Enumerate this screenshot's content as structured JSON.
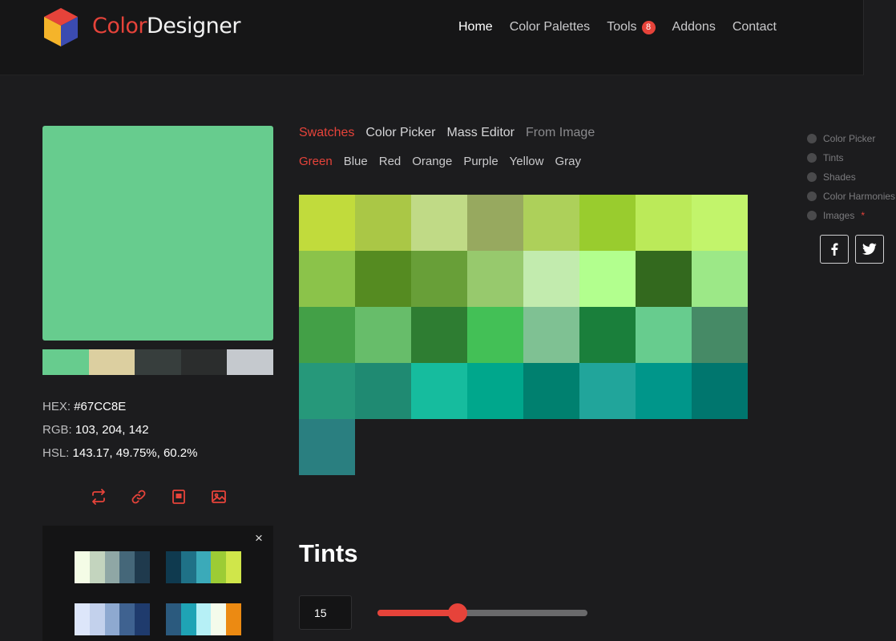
{
  "brand": {
    "name_part1": "Color",
    "name_part2": "Designer"
  },
  "nav": [
    {
      "label": "Home",
      "active": true
    },
    {
      "label": "Color Palettes"
    },
    {
      "label": "Tools",
      "badge": "8"
    },
    {
      "label": "Addons"
    },
    {
      "label": "Contact"
    }
  ],
  "color": {
    "hex_color": "#67CC8E",
    "hex_label": "HEX:",
    "hex_value": "#67CC8E",
    "rgb_label": "RGB:",
    "rgb_value": "103, 204, 142",
    "hsl_label": "HSL:",
    "hsl_value": "143.17, 49.75%, 60.2%",
    "palette": [
      "#67CC8E",
      "#DCCFA0",
      "#373E3D",
      "#2B2D2D",
      "#C5C9CE"
    ]
  },
  "tabs": [
    "Swatches",
    "Color Picker",
    "Mass Editor",
    "From Image"
  ],
  "subtabs": [
    "Green",
    "Blue",
    "Red",
    "Orange",
    "Purple",
    "Yellow",
    "Gray"
  ],
  "swatches": [
    "#C1DB3C",
    "#AAC746",
    "#C0DA86",
    "#97A95F",
    "#ADD05A",
    "#99CC2E",
    "#BBEA59",
    "#C2F46B",
    "#8BC34A",
    "#558B21",
    "#689F38",
    "#97C96D",
    "#C2EBAE",
    "#B2FF8E",
    "#33691E",
    "#9CE887",
    "#43A047",
    "#67BD6A",
    "#2E7D32",
    "#43C056",
    "#7FC193",
    "#1A7F3B",
    "#67CC8E",
    "#468A66",
    "#26987A",
    "#1F8A72",
    "#16BC9E",
    "#00A78C",
    "#00806F",
    "#21A59B",
    "#00968A",
    "#00766E",
    "#2A7F80"
  ],
  "ad": {
    "close": "×",
    "palette_a": [
      "#F4FCE6",
      "#C3D4BE",
      "#8FA7A5",
      "#456779",
      "#1F3A4D"
    ],
    "palette_b": [
      "#0F3A4F",
      "#1F7187",
      "#3BAAB9",
      "#9CCC35",
      "#D0E64A"
    ],
    "palette_c": [
      "#DDE6FA",
      "#C3D1EC",
      "#8EA9D0",
      "#3F6290",
      "#1F3B6D"
    ],
    "palette_d": [
      "#2B5A7E",
      "#1FA3B5",
      "#B6F0F6",
      "#F4FBEB",
      "#EC8A12"
    ]
  },
  "tints": {
    "title": "Tints",
    "count": "15",
    "slider_fraction": 0.38
  },
  "side_nav": [
    {
      "label": "Color Picker"
    },
    {
      "label": "Tints"
    },
    {
      "label": "Shades"
    },
    {
      "label": "Color Harmonies"
    },
    {
      "label": "Images",
      "star": "*"
    }
  ],
  "social": {
    "facebook": "facebook-icon",
    "twitter": "twitter-icon"
  }
}
